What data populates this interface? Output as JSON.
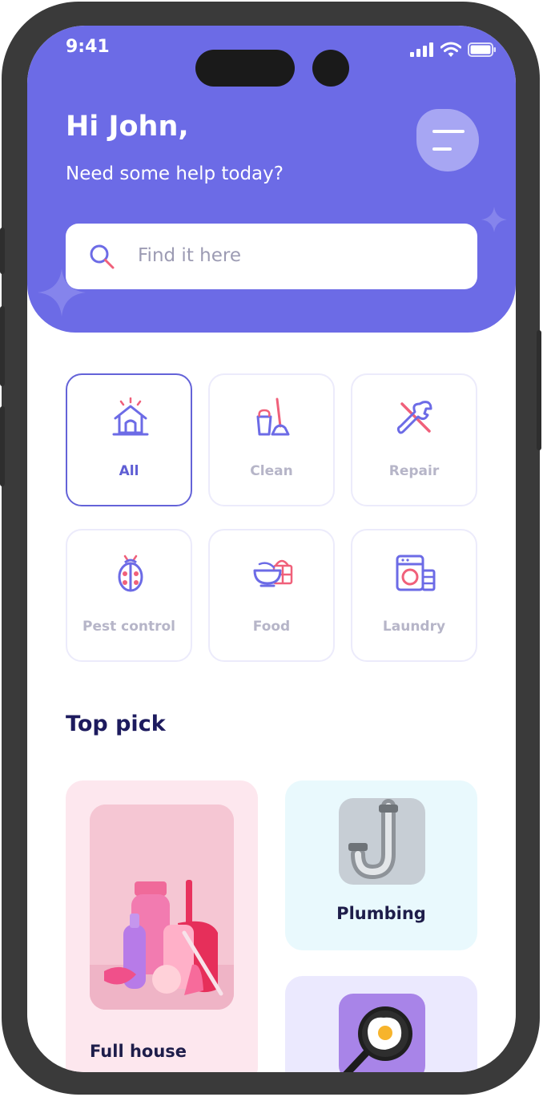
{
  "status_bar": {
    "time": "9:41"
  },
  "header": {
    "greeting": "Hi John,",
    "subtitle": "Need some help today?"
  },
  "search": {
    "placeholder": "Find it here"
  },
  "categories": [
    {
      "label": "All",
      "icon": "house-icon",
      "active": true
    },
    {
      "label": "Clean",
      "icon": "mop-bucket-icon",
      "active": false
    },
    {
      "label": "Repair",
      "icon": "wrench-screwdriver-icon",
      "active": false
    },
    {
      "label": "Pest control",
      "icon": "ladybug-icon",
      "active": false
    },
    {
      "label": "Food",
      "icon": "food-basket-icon",
      "active": false
    },
    {
      "label": "Laundry",
      "icon": "washing-machine-icon",
      "active": false
    }
  ],
  "top_pick": {
    "title": "Top pick",
    "cards": [
      {
        "label": "Full house",
        "image": "cleaning-products-image"
      },
      {
        "label": "Plumbing",
        "image": "pipe-image"
      },
      {
        "label": "",
        "image": "frying-pan-egg-image"
      }
    ]
  },
  "colors": {
    "primary": "#6c6be6",
    "accent_pink": "#f0607a",
    "title_dark": "#1d1b5e"
  }
}
